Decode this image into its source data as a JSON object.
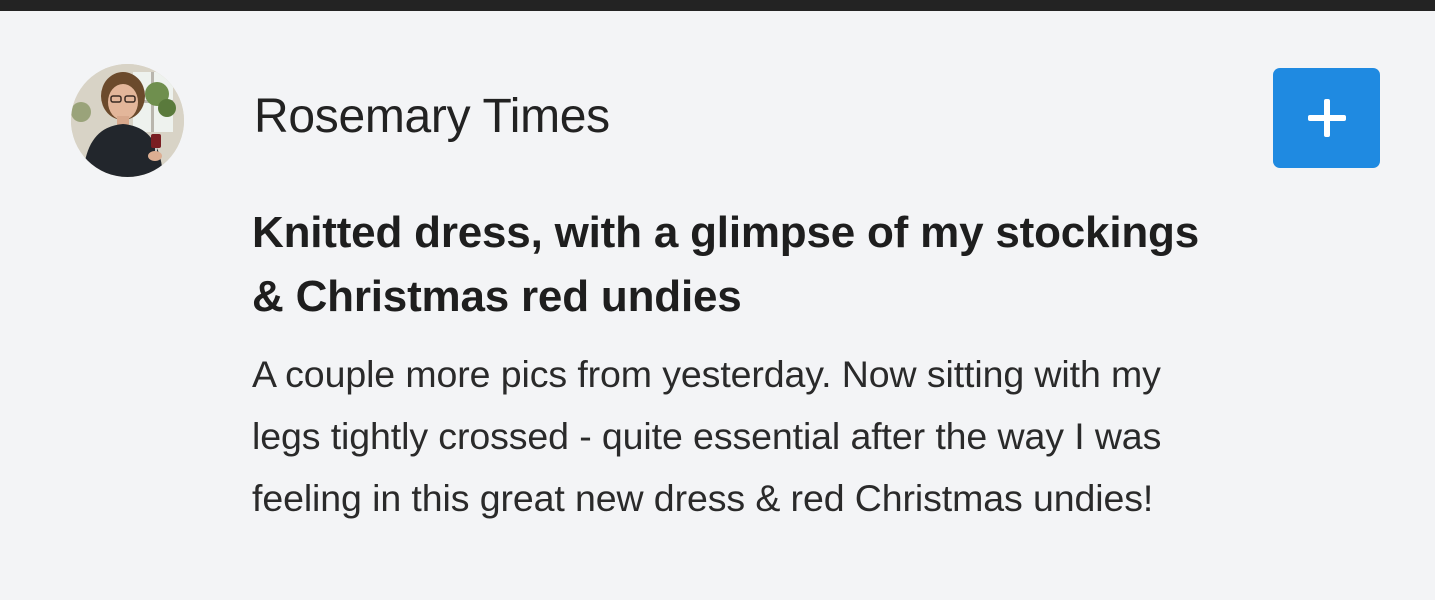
{
  "post": {
    "author": {
      "name": "Rosemary Times",
      "avatar_icon": "profile-photo"
    },
    "follow_button": {
      "icon": "plus-icon",
      "color": "#1f8ae1"
    },
    "title": "Knitted dress, with a glimpse of my stockings & Christmas red undies",
    "body": "A couple more pics from yesterday. Now sitting with my legs tightly crossed - quite essential after the way I was feeling in this great new dress & red Christmas undies!"
  },
  "colors": {
    "top_bar": "#232323",
    "background": "#f3f4f6",
    "accent": "#1f8ae1",
    "text": "#222222"
  }
}
